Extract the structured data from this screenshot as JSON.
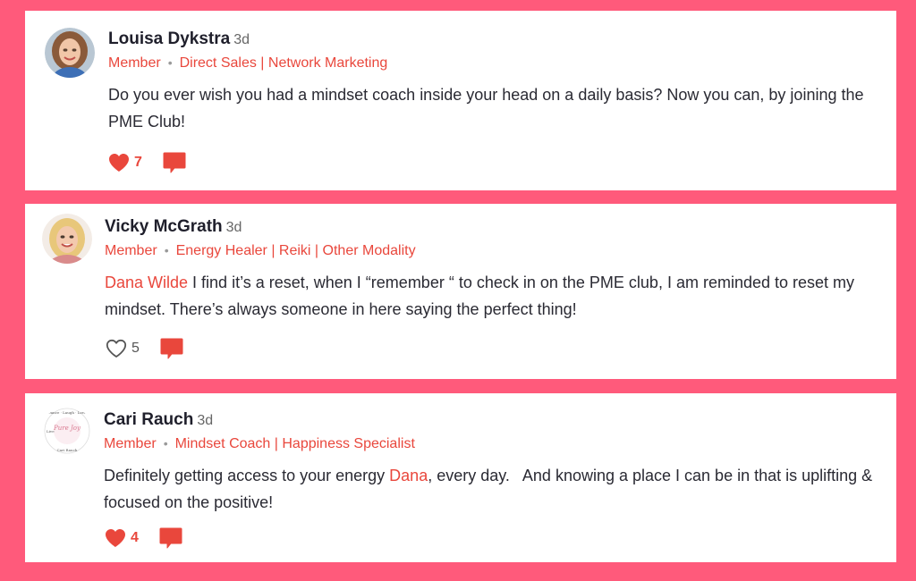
{
  "colors": {
    "page_background": "#ff5a7b",
    "accent": "#e9473c",
    "card": "#ffffff"
  },
  "posts": [
    {
      "author": "Louisa Dykstra",
      "time": "3d",
      "role": "Member",
      "tags": "Direct Sales | Network Marketing",
      "mention": "",
      "body_parts": [
        "Do you ever wish you had a mindset coach inside your head on a daily basis? Now you can, by joining the PME Club!"
      ],
      "likes": "7",
      "liked": true,
      "avatar": "photo-avatar"
    },
    {
      "author": "Vicky McGrath",
      "time": "3d",
      "role": "Member",
      "tags": "Energy Healer | Reiki | Other Modality",
      "mention": "Dana Wilde",
      "body_parts": [
        " I find it’s a reset, when I “remember “ to check in on the PME club, I am reminded to reset my mindset. There’s always someone in here saying the perfect thing!"
      ],
      "likes": "5",
      "liked": false,
      "avatar": "photo-avatar"
    },
    {
      "author": "Cari Rauch",
      "time": "3d",
      "role": "Member",
      "tags": "Mindset Coach | Happiness Specialist",
      "mention": "Dana",
      "body_parts": [
        "Definitely getting access to your energy ",
        ", every day.   And knowing a place I can be in that is uplifting & focused on the positive!"
      ],
      "likes": "4",
      "liked": true,
      "avatar": "logo-avatar",
      "avatar_text": {
        "center": "Pure Joy",
        "ring": "Dance · Laugh · Love · Cari Rauch · Live"
      }
    }
  ]
}
